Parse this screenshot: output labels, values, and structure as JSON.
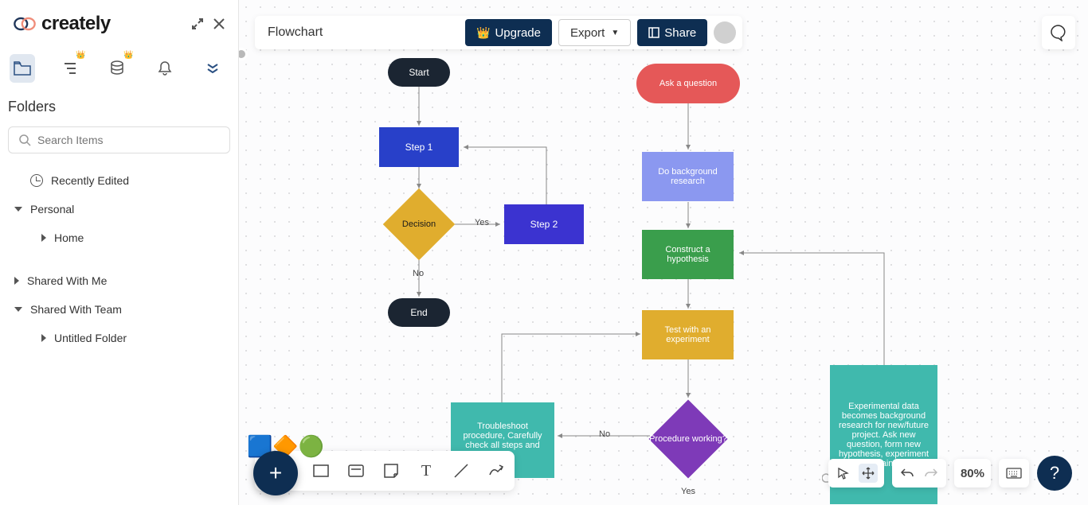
{
  "app": {
    "name": "creately"
  },
  "sidebar": {
    "title": "Folders",
    "search_placeholder": "Search Items",
    "recently": "Recently Edited",
    "personal": "Personal",
    "home": "Home",
    "shared_me": "Shared With Me",
    "shared_team": "Shared With Team",
    "untitled": "Untitled Folder"
  },
  "topbar": {
    "doc_title": "Flowchart",
    "upgrade": "Upgrade",
    "export": "Export",
    "share": "Share"
  },
  "flow": {
    "start": "Start",
    "step1": "Step 1",
    "decision": "Decision",
    "yes": "Yes",
    "no": "No",
    "step2": "Step 2",
    "end": "End",
    "ask": "Ask a question",
    "research": "Do background research",
    "hypothesis": "Construct a hypothesis",
    "test": "Test with an experiment",
    "troubleshoot": "Troubleshoot procedure, Carefully check all steps and setup",
    "procedure": "Procedure working?",
    "experimental": "Experimental data becomes background research for new/future project. Ask new question, form new hypothesis, experiment again!",
    "yes2": "Yes",
    "no2": "No"
  },
  "bottom_right": {
    "zoom": "80%"
  }
}
